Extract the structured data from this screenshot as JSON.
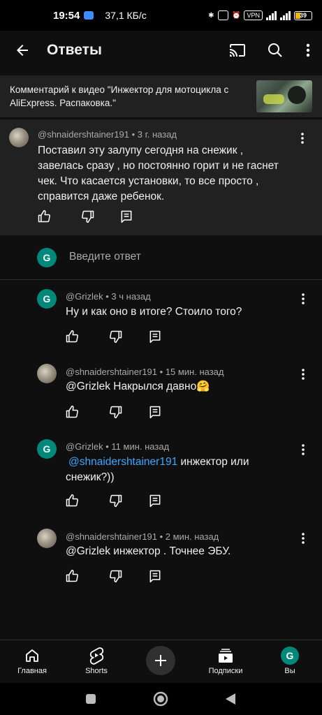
{
  "status_bar": {
    "time": "19:54",
    "speed": "37,1 КБ/с",
    "vpn": "VPN",
    "battery": "39"
  },
  "appbar": {
    "title": "Ответы"
  },
  "video_context": {
    "text": "Комментарий к видео \"Инжектор для мотоцикла с AliExpress. Распаковка.\""
  },
  "parent_comment": {
    "meta": "@shnaidershtainer191 • 3 г. назад",
    "text": "Поставил эту залупу сегодня на снежик , завелась сразу , но постоянно горит и не гаснет чек. Что касается установки, то все просто , справится даже ребенок."
  },
  "reply_input": {
    "avatar_letter": "G",
    "placeholder": "Введите ответ"
  },
  "replies": [
    {
      "meta": "@Grizlek • 3 ч назад",
      "avatar_letter": "G",
      "text": "Ну и как оно в итоге? Стоило того?"
    },
    {
      "meta": "@shnaidershtainer191 • 15 мин. назад",
      "text": "@Grizlek  Накрылся давно🤗"
    },
    {
      "meta": "@Grizlek • 11 мин. назад",
      "avatar_letter": "G",
      "mention": "@shnaidershtainer191",
      "text": "  инжектор или снежик?))"
    },
    {
      "meta": "@shnaidershtainer191 • 2 мин. назад",
      "text": "@Grizlek  инжектор . Точнее ЭБУ."
    }
  ],
  "bottom_nav": {
    "home": "Главная",
    "shorts": "Shorts",
    "subscriptions": "Подписки",
    "you": "Вы",
    "you_letter": "G"
  },
  "colors": {
    "background": "#0f0f0f",
    "card": "#212121",
    "mention": "#3ea6ff",
    "avatar_green": "#00897b"
  }
}
